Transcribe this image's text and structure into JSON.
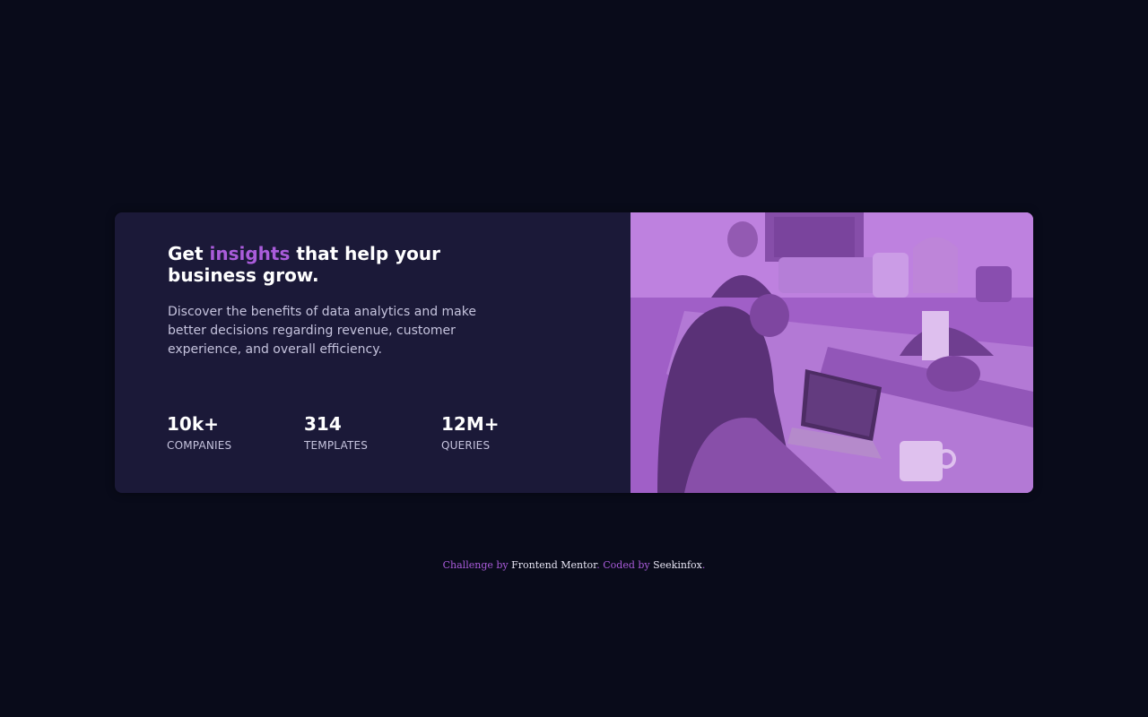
{
  "hero": {
    "title_pre": "Get ",
    "title_accent": "insights",
    "title_post": " that help your business grow.",
    "description": "Discover the benefits of data analytics and make better decisions regarding revenue, customer experience, and overall efficiency."
  },
  "stats": [
    {
      "value": "10k+",
      "label": "COMPANIES"
    },
    {
      "value": "314",
      "label": "TEMPLATES"
    },
    {
      "value": "12M+",
      "label": "QUERIES"
    }
  ],
  "image": {
    "subject": "office-team-meeting-photo",
    "tint": "#aa5cdb"
  },
  "footer": {
    "challenge_text": "Challenge by ",
    "challenge_link": "Frontend Mentor",
    "separator": ". ",
    "coded_text": "Coded by ",
    "coded_link": "Seekinfox",
    "end": "."
  },
  "colors": {
    "background": "#090b1a",
    "card": "#1b1938",
    "accent": "#aa5cdb",
    "text": "#ffffff",
    "muted": "#c5c3dd"
  }
}
